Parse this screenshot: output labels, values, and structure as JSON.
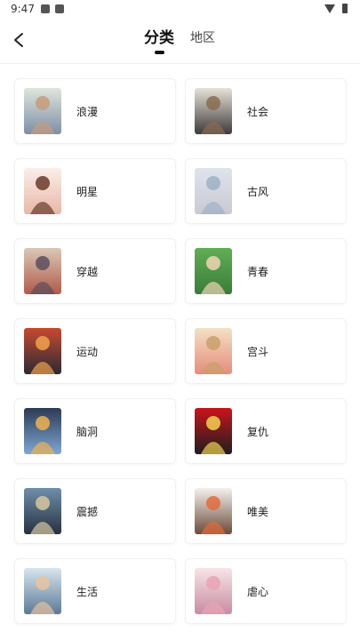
{
  "status_bar": {
    "time": "9:47"
  },
  "header": {
    "tabs": [
      {
        "label": "分类",
        "active": true
      },
      {
        "label": "地区",
        "active": false
      }
    ]
  },
  "categories": [
    {
      "label": "浪漫",
      "colors": [
        "#dfe6dc",
        "#c79c7a",
        "#7d8fa6"
      ]
    },
    {
      "label": "社会",
      "colors": [
        "#e7e2d8",
        "#8a6c52",
        "#3e3a3a"
      ]
    },
    {
      "label": "明星",
      "colors": [
        "#fbeee8",
        "#6a3a2c",
        "#e7b8a6"
      ]
    },
    {
      "label": "古风",
      "colors": [
        "#dfe4ec",
        "#9fb0c7",
        "#c9c9d2"
      ]
    },
    {
      "label": "穿越",
      "colors": [
        "#d9c8b8",
        "#5a4f5d",
        "#b05a4a"
      ]
    },
    {
      "label": "青春",
      "colors": [
        "#5fae54",
        "#f1d3b7",
        "#3b7c3a"
      ]
    },
    {
      "label": "运动",
      "colors": [
        "#c64a2f",
        "#f2a24b",
        "#2a2a35"
      ]
    },
    {
      "label": "宫斗",
      "colors": [
        "#f4e0c5",
        "#c9a06a",
        "#e58d7a"
      ]
    },
    {
      "label": "脑洞",
      "colors": [
        "#2d3b55",
        "#f0b24f",
        "#7da7d4"
      ]
    },
    {
      "label": "复仇",
      "colors": [
        "#c8141b",
        "#f2d24d",
        "#1e1e1e"
      ]
    },
    {
      "label": "震撼",
      "colors": [
        "#6f8fa8",
        "#d9c7a1",
        "#263140"
      ]
    },
    {
      "label": "唯美",
      "colors": [
        "#f5f0ec",
        "#e36b3a",
        "#6b4b3a"
      ]
    },
    {
      "label": "生活",
      "colors": [
        "#d7e5ef",
        "#e8c39f",
        "#5b7a96"
      ]
    },
    {
      "label": "虐心",
      "colors": [
        "#f7e4e8",
        "#e7a5b6",
        "#c88ca0"
      ]
    }
  ]
}
